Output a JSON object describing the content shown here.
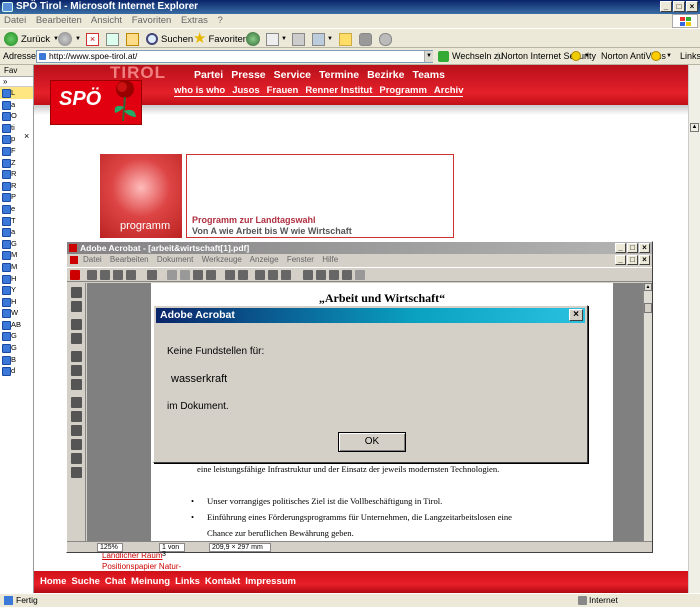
{
  "ie": {
    "title": "SPÖ Tirol - Microsoft Internet Explorer",
    "menu": [
      "Datei",
      "Bearbeiten",
      "Ansicht",
      "Favoriten",
      "Extras",
      "?"
    ],
    "toolbar": {
      "back": "Zurück",
      "search": "Suchen",
      "favorites": "Favoriten"
    },
    "address_label": "Adresse",
    "url": "http://www.spoe-tirol.at/",
    "go_label": "Wechseln zu",
    "norton_security": "Norton Internet Security",
    "norton_antivirus": "Norton AntiVirus",
    "links_label": "Links",
    "status_left": "Fertig",
    "status_zone": "Internet"
  },
  "favorites": {
    "header": "Fav",
    "items": [
      "L",
      "a",
      "O",
      "ti",
      "p",
      "F",
      "Z",
      "R",
      "R",
      "P",
      "e",
      "T",
      "a",
      "G",
      "M",
      "M",
      "H",
      "Y",
      "H",
      "W",
      "AB",
      "G",
      "G",
      "B",
      "d"
    ]
  },
  "site": {
    "region": "TIROL",
    "logo": "SPÖ",
    "nav_main": [
      "Partei",
      "Presse",
      "Service",
      "Termine",
      "Bezirke",
      "Teams"
    ],
    "nav_sub": [
      "who is who",
      "Jusos",
      "Frauen",
      "Renner Institut",
      "Programm",
      "Archiv"
    ],
    "program_label": "programm",
    "program_title": "Programm zur Landtagswahl",
    "program_subtitle": "Von A wie Arbeit bis W wie Wirtschaft",
    "link_left1": "Ländlicher Raum",
    "link_left2": "Positionspapier Natur-",
    "footer": [
      "Home",
      "Suche",
      "Chat",
      "Meinung",
      "Links",
      "Kontakt",
      "Impressum"
    ]
  },
  "acrobat": {
    "title": "Adobe Acrobat - [arbeit&wirtschaft[1].pdf]",
    "menu": [
      "Datei",
      "Bearbeiten",
      "Dokument",
      "Werkzeuge",
      "Anzeige",
      "Fenster",
      "Hilfe"
    ],
    "doc_title": "„Arbeit und Wirtschaft“",
    "doc_line1": "eine leistungsfähige Infrastruktur und der Einsatz der jeweils modernsten Technologien.",
    "doc_bullet1": "Unser vorrangiges politisches Ziel ist die Vollbeschäftigung in Tirol.",
    "doc_bullet2": "Einführung eines Förderungsprogramms für Unternehmen, die Langzeitarbeitslosen eine",
    "doc_bullet2b": "Chance zur beruflichen Bewährung geben.",
    "zoom": "125%",
    "page_of": "1 von 3",
    "page_size": "209,9 × 297 mm"
  },
  "dialog": {
    "title": "Adobe Acrobat",
    "line1": "Keine Fundstellen für:",
    "term": "wasserkraft",
    "line3": "im Dokument.",
    "ok": "OK"
  }
}
